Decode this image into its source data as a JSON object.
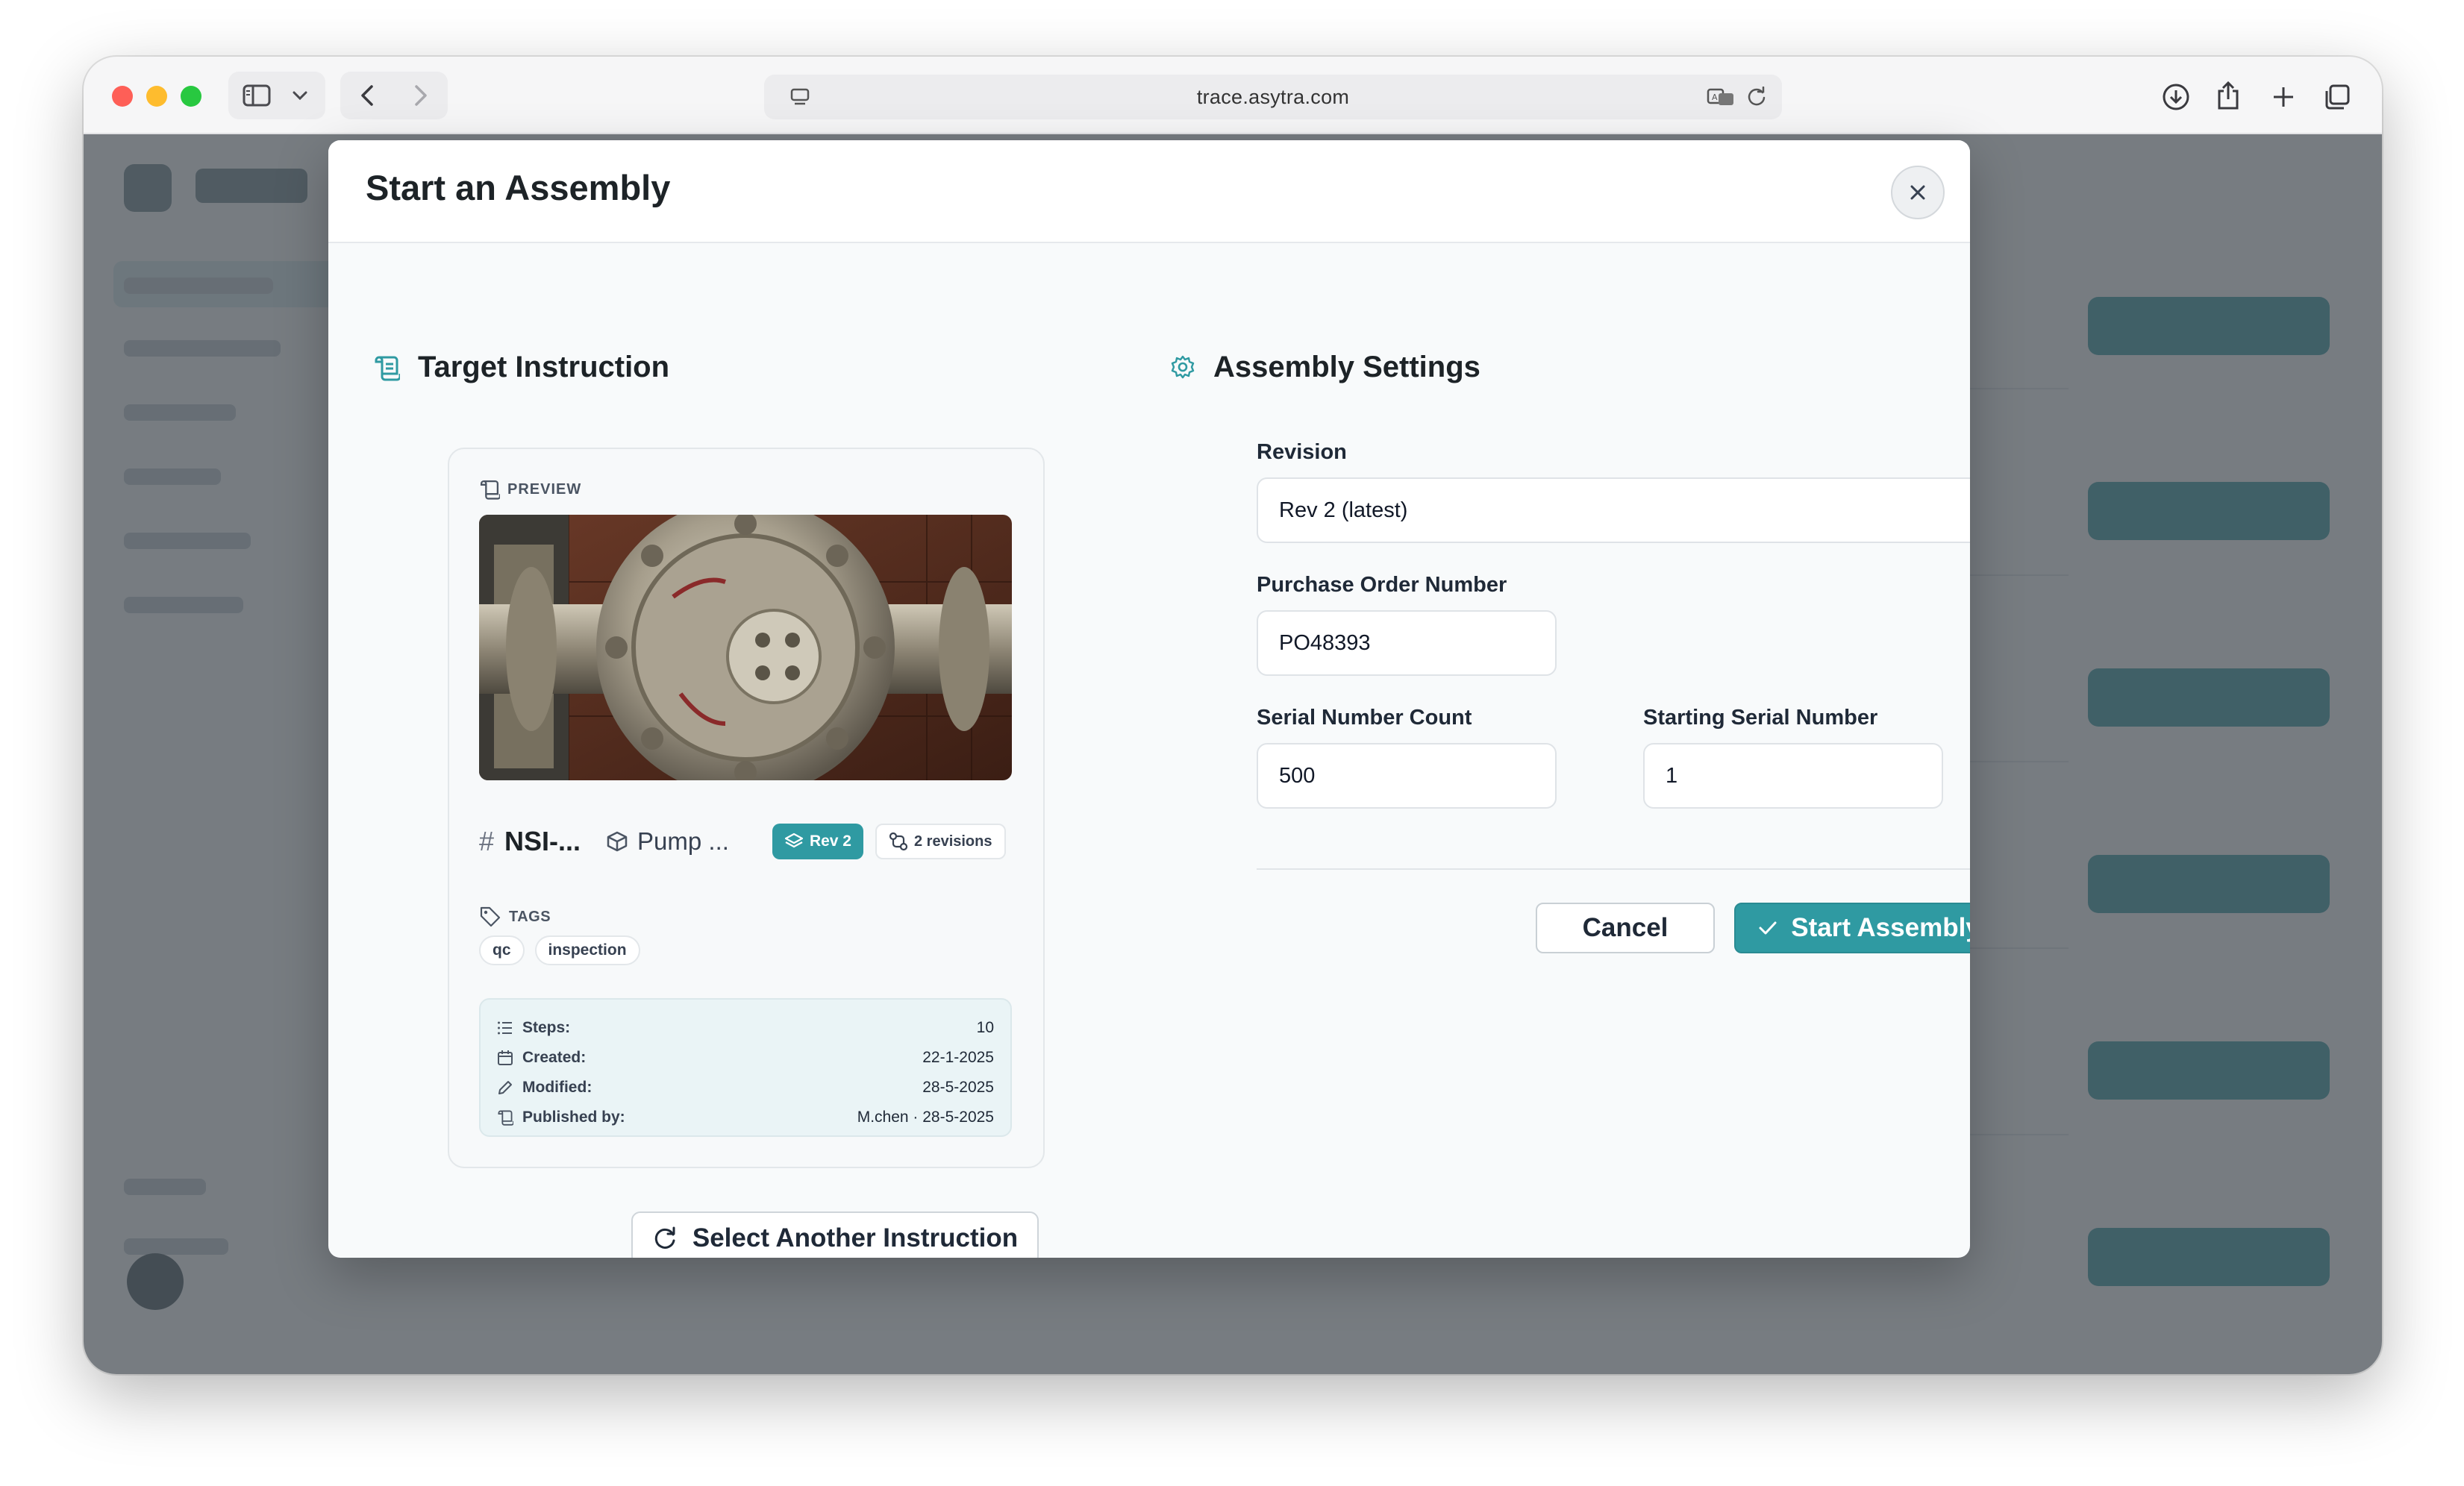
{
  "browser": {
    "url": "trace.asytra.com"
  },
  "modal": {
    "title": "Start an Assembly",
    "target_section_title": "Target Instruction",
    "settings_section_title": "Assembly Settings"
  },
  "preview": {
    "label": "PREVIEW",
    "instruction_id": "NSI-...",
    "product": "Pump ...",
    "rev_badge": "Rev 2",
    "revisions_badge": "2 revisions",
    "tags_label": "TAGS",
    "tags": [
      "qc",
      "inspection"
    ],
    "stats": [
      {
        "key": "Steps:",
        "value": "10",
        "icon": "list-icon"
      },
      {
        "key": "Created:",
        "value": "22-1-2025",
        "icon": "calendar-icon"
      },
      {
        "key": "Modified:",
        "value": "28-5-2025",
        "icon": "pencil-icon"
      },
      {
        "key": "Published by:",
        "value": "M.chen · 28-5-2025",
        "icon": "publish-icon"
      }
    ],
    "select_another_label": "Select Another Instruction"
  },
  "settings": {
    "revision_label": "Revision",
    "revision_value": "Rev 2 (latest)",
    "po_label": "Purchase Order Number",
    "po_value": "PO48393",
    "serial_count_label": "Serial Number Count",
    "serial_count_value": "500",
    "starting_serial_label": "Starting Serial Number",
    "starting_serial_value": "1",
    "cancel_label": "Cancel",
    "start_label": "Start Assembly"
  },
  "colors": {
    "accent": "#2f9aa2",
    "backdrop": "#464e54"
  }
}
